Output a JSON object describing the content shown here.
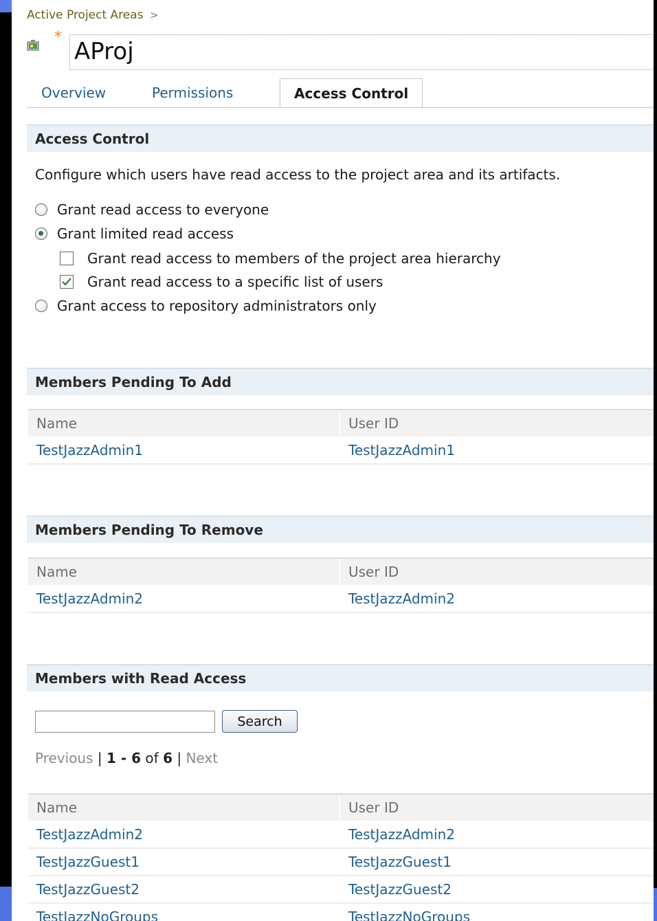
{
  "breadcrumb": {
    "label": "Active Project Areas",
    "separator": ">"
  },
  "project": {
    "title": "AProj",
    "dirty_marker": "*"
  },
  "tabs": [
    {
      "label": "Overview"
    },
    {
      "label": "Permissions"
    },
    {
      "label": "Access Control",
      "active": true
    }
  ],
  "access_control": {
    "heading": "Access Control",
    "description": "Configure which users have read access to the project area and its artifacts.",
    "options": {
      "everyone": "Grant read access to everyone",
      "limited": "Grant limited read access",
      "members_hierarchy": "Grant read access to members of the project area hierarchy",
      "specific_list": "Grant read access to a specific list of users",
      "admins_only": "Grant access to repository administrators only"
    },
    "state": {
      "everyone": false,
      "limited": true,
      "members_hierarchy": false,
      "specific_list": true,
      "admins_only": false
    }
  },
  "pending_add": {
    "heading": "Members Pending To Add",
    "columns": [
      "Name",
      "User ID"
    ],
    "rows": [
      {
        "name": "TestJazzAdmin1",
        "user_id": "TestJazzAdmin1"
      }
    ]
  },
  "pending_remove": {
    "heading": "Members Pending To Remove",
    "columns": [
      "Name",
      "User ID"
    ],
    "rows": [
      {
        "name": "TestJazzAdmin2",
        "user_id": "TestJazzAdmin2"
      }
    ]
  },
  "read_access": {
    "heading": "Members with Read Access",
    "search": {
      "value": "",
      "button_label": "Search"
    },
    "pager": {
      "previous": "Previous",
      "separator": "|",
      "range": "1 - 6",
      "of_label": "of",
      "total": "6",
      "next": "Next"
    },
    "columns": [
      "Name",
      "User ID"
    ],
    "rows": [
      {
        "name": "TestJazzAdmin2",
        "user_id": "TestJazzAdmin2"
      },
      {
        "name": "TestJazzGuest1",
        "user_id": "TestJazzGuest1"
      },
      {
        "name": "TestJazzGuest2",
        "user_id": "TestJazzGuest2"
      },
      {
        "name": "TestJazzNoGroups",
        "user_id": "TestJazzNoGroups"
      }
    ]
  },
  "colors": {
    "link": "#1f5f8f",
    "section_bg": "#e9f0f6",
    "accent_star": "#f0882a",
    "frame": "#000000"
  }
}
